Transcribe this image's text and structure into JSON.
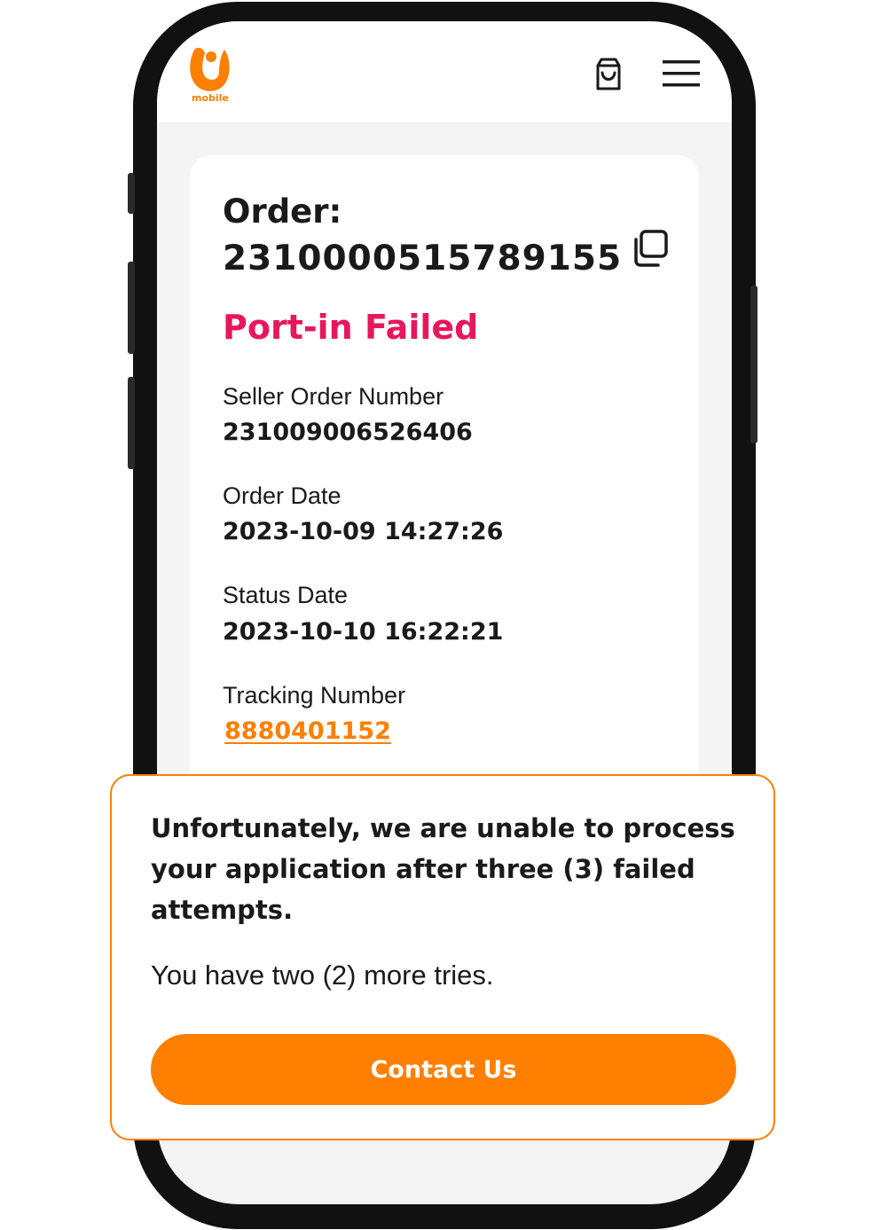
{
  "brand": {
    "logo_text": "mobile",
    "accent_color": "#ff7f00",
    "status_color": "#e8175d"
  },
  "header": {
    "cart_icon": "shopping-bag-icon",
    "menu_icon": "hamburger-menu-icon"
  },
  "order": {
    "label": "Order:",
    "number": "2310000515789155",
    "copy_icon": "copy-icon",
    "status": "Port-in Failed",
    "fields": [
      {
        "label": "Seller Order Number",
        "value": "231009006526406"
      },
      {
        "label": "Order Date",
        "value": "2023-10-09 14:27:26"
      },
      {
        "label": "Status Date",
        "value": "2023-10-10 16:22:21"
      },
      {
        "label": "Tracking Number",
        "value": "8880401152"
      }
    ]
  },
  "popup": {
    "message": "Unfortunately, we are unable to process your application after three (3) failed attempts.",
    "sub_message": "You have two (2) more tries.",
    "button_label": "Contact Us"
  }
}
